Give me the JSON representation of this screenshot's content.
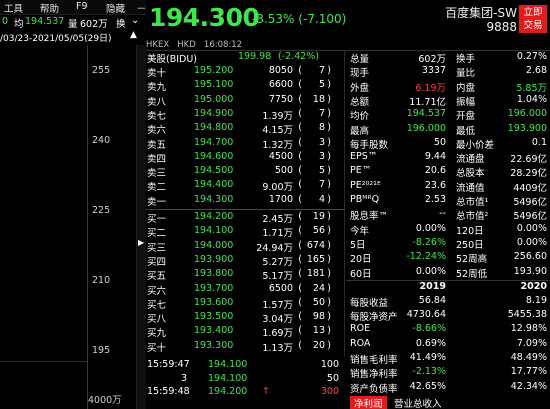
{
  "menu": {
    "items": [
      "工具",
      "帮助",
      "F9",
      "隐藏",
      "ㅡ"
    ]
  },
  "ticker": {
    "prefix": "0",
    "avg_label": "均",
    "avg_value": "194.537",
    "vol_label": "量",
    "vol_value": "602万",
    "switch_label": "换"
  },
  "daterange": {
    "text": "/03/23-2021/05/05(29日)"
  },
  "chart": {
    "y_labels": [
      "255",
      "240",
      "225",
      "210",
      "195"
    ],
    "vol_label": "4000万"
  },
  "header": {
    "price": "194.300",
    "change": "-3.53% (-7.100)",
    "name": "百度集团-SW",
    "code": "9888",
    "trade_button": "立即\n交易",
    "exchange": "HKEX",
    "currency": "HKD",
    "time": "16:08:12"
  },
  "orderbook": {
    "us_row": {
      "label": "美股(BIDU)",
      "price": "199.98",
      "change": "(-2.42%)"
    },
    "asks": [
      {
        "label": "卖十",
        "price": "195.200",
        "qty": "8050",
        "orders": "7"
      },
      {
        "label": "卖九",
        "price": "195.100",
        "qty": "6600",
        "orders": "5"
      },
      {
        "label": "卖八",
        "price": "195.000",
        "qty": "7750",
        "orders": "18"
      },
      {
        "label": "卖七",
        "price": "194.900",
        "qty": "1.39万",
        "orders": "7"
      },
      {
        "label": "卖六",
        "price": "194.800",
        "qty": "4.15万",
        "orders": "8"
      },
      {
        "label": "卖五",
        "price": "194.700",
        "qty": "1.32万",
        "orders": "3"
      },
      {
        "label": "卖四",
        "price": "194.600",
        "qty": "4500",
        "orders": "3"
      },
      {
        "label": "卖三",
        "price": "194.500",
        "qty": "500",
        "orders": "5"
      },
      {
        "label": "卖二",
        "price": "194.400",
        "qty": "9.00万",
        "orders": "7"
      },
      {
        "label": "卖一",
        "price": "194.300",
        "qty": "1700",
        "orders": "4"
      }
    ],
    "bids": [
      {
        "label": "买一",
        "price": "194.200",
        "qty": "2.45万",
        "orders": "19"
      },
      {
        "label": "买二",
        "price": "194.100",
        "qty": "1.71万",
        "orders": "56"
      },
      {
        "label": "买三",
        "price": "194.000",
        "qty": "24.94万",
        "orders": "674"
      },
      {
        "label": "买四",
        "price": "193.900",
        "qty": "5.27万",
        "orders": "165"
      },
      {
        "label": "买五",
        "price": "193.800",
        "qty": "5.17万",
        "orders": "181"
      },
      {
        "label": "买六",
        "price": "193.700",
        "qty": "6500",
        "orders": "24"
      },
      {
        "label": "买七",
        "price": "193.600",
        "qty": "1.57万",
        "orders": "50"
      },
      {
        "label": "买八",
        "price": "193.500",
        "qty": "3.04万",
        "orders": "98"
      },
      {
        "label": "买九",
        "price": "193.400",
        "qty": "1.69万",
        "orders": "13"
      },
      {
        "label": "买十",
        "price": "193.300",
        "qty": "1.13万",
        "orders": "20"
      }
    ]
  },
  "ticks": [
    {
      "time": "15:59:47",
      "price": "194.100",
      "arrow": "",
      "vol": "100"
    },
    {
      "time": "3",
      "price": "194.100",
      "arrow": "",
      "vol": "50"
    },
    {
      "time": "15:59:48",
      "price": "194.200",
      "arrow": "↑",
      "vol": "300"
    }
  ],
  "stats": {
    "rows": [
      {
        "l1": "总量",
        "v1": "602万",
        "l2": "换手",
        "v2": "0.27%",
        "c1": "w",
        "c2": "w"
      },
      {
        "l1": "现手",
        "v1": "3337",
        "l2": "量比",
        "v2": "2.68",
        "c1": "w",
        "c2": "w"
      },
      {
        "l1": "外盘",
        "v1": "6.19万",
        "l2": "内盘",
        "v2": "5.85万",
        "c1": "r",
        "c2": "g"
      },
      {
        "l1": "总额",
        "v1": "11.71亿",
        "l2": "振幅",
        "v2": "1.04%",
        "c1": "w",
        "c2": "w"
      },
      {
        "l1": "均价",
        "v1": "194.537",
        "l2": "开盘",
        "v2": "196.000",
        "c1": "g",
        "c2": "g"
      },
      {
        "l1": "最高",
        "v1": "196.000",
        "l2": "最低",
        "v2": "193.900",
        "c1": "g",
        "c2": "g"
      },
      {
        "l1": "每手股数",
        "v1": "50",
        "l2": "最小价差",
        "v2": "0.1",
        "c1": "w",
        "c2": "w"
      },
      {
        "l1": "EPS™",
        "v1": "9.44",
        "l2": "流通盘",
        "v2": "22.69亿",
        "c1": "w",
        "c2": "w"
      },
      {
        "l1": "PE™",
        "v1": "20.6",
        "l2": "总股本",
        "v2": "28.29亿",
        "c1": "w",
        "c2": "w"
      },
      {
        "l1": "PE²⁰²¹ᴱ",
        "v1": "23.6",
        "l2": "流通值",
        "v2": "4409亿",
        "c1": "w",
        "c2": "w"
      },
      {
        "l1": "PBᴹᴿQ",
        "v1": "2.53",
        "l2": "总市值¹",
        "v2": "5496亿",
        "c1": "w",
        "c2": "w"
      },
      {
        "l1": "股息率™",
        "v1": "--",
        "l2": "总市值²",
        "v2": "5496亿",
        "c1": "w",
        "c2": "w"
      },
      {
        "l1": "今年",
        "v1": "0.00%",
        "l2": "120日",
        "v2": "0.00%",
        "c1": "w",
        "c2": "w"
      },
      {
        "l1": "5日",
        "v1": "-8.26%",
        "l2": "250日",
        "v2": "0.00%",
        "c1": "g",
        "c2": "w"
      },
      {
        "l1": "20日",
        "v1": "-12.24%",
        "l2": "52周高",
        "v2": "256.60",
        "c1": "g",
        "c2": "w"
      },
      {
        "l1": "60日",
        "v1": "0.00%",
        "l2": "52周低",
        "v2": "193.90",
        "c1": "w",
        "c2": "w"
      }
    ],
    "fin_header": {
      "y1": "2019",
      "y2": "2020"
    },
    "fin_rows": [
      {
        "label": "每股收益",
        "v1": "56.84",
        "v2": "8.19",
        "c1": "w",
        "c2": "w"
      },
      {
        "label": "每股净资产",
        "v1": "4730.64",
        "v2": "5455.38",
        "c1": "w",
        "c2": "w"
      },
      {
        "label": "ROE",
        "v1": "-8.66%",
        "v2": "12.98%",
        "c1": "g",
        "c2": "w"
      },
      {
        "label": "ROA",
        "v1": "0.69%",
        "v2": "7.09%",
        "c1": "w",
        "c2": "w"
      },
      {
        "label": "销售毛利率",
        "v1": "41.49%",
        "v2": "48.49%",
        "c1": "w",
        "c2": "w"
      },
      {
        "label": "销售净利率",
        "v1": "-2.13%",
        "v2": "17.77%",
        "c1": "g",
        "c2": "w"
      },
      {
        "label": "资产负债率",
        "v1": "42.65%",
        "v2": "42.34%",
        "c1": "w",
        "c2": "w"
      }
    ]
  },
  "bottom_tabs": [
    "净利润",
    "营业总收入"
  ],
  "colors": {
    "up": "#ff3b3b",
    "down": "#3ce64c",
    "accent": "#e11b1b"
  }
}
